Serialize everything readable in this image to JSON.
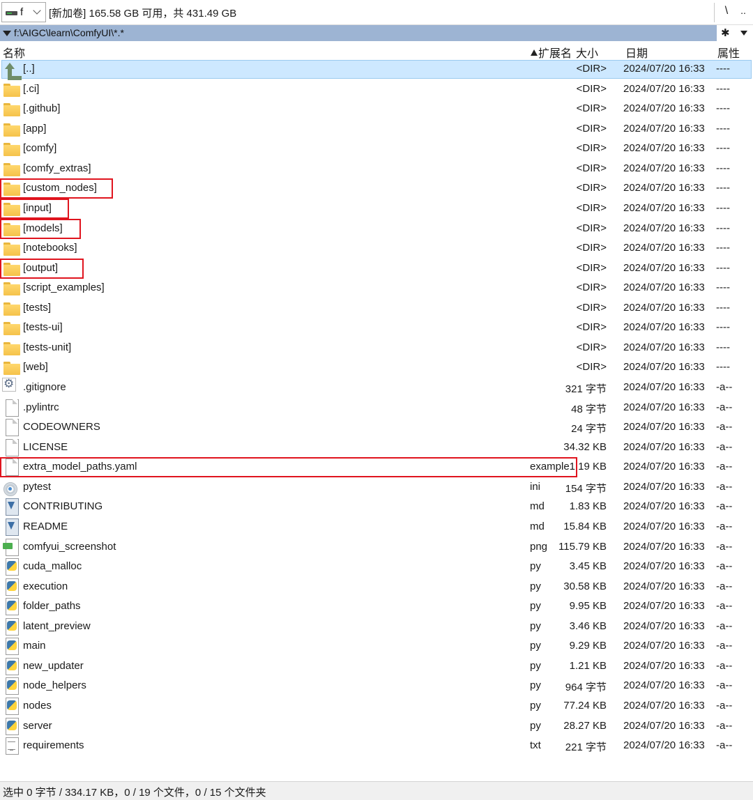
{
  "drive": {
    "letter": "f",
    "info": "[新加卷]  165.58 GB 可用，共 431.49 GB",
    "root_button": "\\",
    "up_button": ".."
  },
  "path": {
    "text": "f:\\AIGC\\learn\\ComfyUI\\*.*",
    "star_button": "✱"
  },
  "columns": {
    "name": "名称",
    "ext": "扩展名",
    "size": "大小",
    "date": "日期",
    "attr": "属性"
  },
  "colors": {
    "path_bar": "#9db4d3",
    "selection": "#cde8ff",
    "highlight_box": "#e0141e",
    "folder": "#f5c24a"
  },
  "files": [
    {
      "name": "[..]",
      "ext": "",
      "size": "<DIR>",
      "date": "2024/07/20 16:33",
      "attr": "----",
      "icon": "up-dir-icon",
      "selected": true
    },
    {
      "name": "[.ci]",
      "ext": "",
      "size": "<DIR>",
      "date": "2024/07/20 16:33",
      "attr": "----",
      "icon": "folder-icon"
    },
    {
      "name": "[.github]",
      "ext": "",
      "size": "<DIR>",
      "date": "2024/07/20 16:33",
      "attr": "----",
      "icon": "folder-icon"
    },
    {
      "name": "[app]",
      "ext": "",
      "size": "<DIR>",
      "date": "2024/07/20 16:33",
      "attr": "----",
      "icon": "folder-icon"
    },
    {
      "name": "[comfy]",
      "ext": "",
      "size": "<DIR>",
      "date": "2024/07/20 16:33",
      "attr": "----",
      "icon": "folder-icon"
    },
    {
      "name": "[comfy_extras]",
      "ext": "",
      "size": "<DIR>",
      "date": "2024/07/20 16:33",
      "attr": "----",
      "icon": "folder-icon"
    },
    {
      "name": "[custom_nodes]",
      "ext": "",
      "size": "<DIR>",
      "date": "2024/07/20 16:33",
      "attr": "----",
      "icon": "folder-icon",
      "highlighted": true
    },
    {
      "name": "[input]",
      "ext": "",
      "size": "<DIR>",
      "date": "2024/07/20 16:33",
      "attr": "----",
      "icon": "folder-icon",
      "highlighted": true
    },
    {
      "name": "[models]",
      "ext": "",
      "size": "<DIR>",
      "date": "2024/07/20 16:33",
      "attr": "----",
      "icon": "folder-icon",
      "highlighted": true
    },
    {
      "name": "[notebooks]",
      "ext": "",
      "size": "<DIR>",
      "date": "2024/07/20 16:33",
      "attr": "----",
      "icon": "folder-icon"
    },
    {
      "name": "[output]",
      "ext": "",
      "size": "<DIR>",
      "date": "2024/07/20 16:33",
      "attr": "----",
      "icon": "folder-icon",
      "highlighted": true
    },
    {
      "name": "[script_examples]",
      "ext": "",
      "size": "<DIR>",
      "date": "2024/07/20 16:33",
      "attr": "----",
      "icon": "folder-icon"
    },
    {
      "name": "[tests]",
      "ext": "",
      "size": "<DIR>",
      "date": "2024/07/20 16:33",
      "attr": "----",
      "icon": "folder-icon"
    },
    {
      "name": "[tests-ui]",
      "ext": "",
      "size": "<DIR>",
      "date": "2024/07/20 16:33",
      "attr": "----",
      "icon": "folder-icon"
    },
    {
      "name": "[tests-unit]",
      "ext": "",
      "size": "<DIR>",
      "date": "2024/07/20 16:33",
      "attr": "----",
      "icon": "folder-icon"
    },
    {
      "name": "[web]",
      "ext": "",
      "size": "<DIR>",
      "date": "2024/07/20 16:33",
      "attr": "----",
      "icon": "folder-icon"
    },
    {
      "name": ".gitignore",
      "ext": "",
      "size": "321 字节",
      "date": "2024/07/20 16:33",
      "attr": "-a--",
      "icon": "gear-file-icon"
    },
    {
      "name": ".pylintrc",
      "ext": "",
      "size": "48 字节",
      "date": "2024/07/20 16:33",
      "attr": "-a--",
      "icon": "file-icon"
    },
    {
      "name": "CODEOWNERS",
      "ext": "",
      "size": "24 字节",
      "date": "2024/07/20 16:33",
      "attr": "-a--",
      "icon": "file-icon"
    },
    {
      "name": "LICENSE",
      "ext": "",
      "size": "34.32 KB",
      "date": "2024/07/20 16:33",
      "attr": "-a--",
      "icon": "file-icon"
    },
    {
      "name": "extra_model_paths.yaml",
      "ext": "example",
      "size": "1.19 KB",
      "date": "2024/07/20 16:33",
      "attr": "-a--",
      "icon": "file-icon",
      "highlighted": true
    },
    {
      "name": "pytest",
      "ext": "ini",
      "size": "154 字节",
      "date": "2024/07/20 16:33",
      "attr": "-a--",
      "icon": "ini-settings-icon"
    },
    {
      "name": "CONTRIBUTING",
      "ext": "md",
      "size": "1.83 KB",
      "date": "2024/07/20 16:33",
      "attr": "-a--",
      "icon": "markdown-icon"
    },
    {
      "name": "README",
      "ext": "md",
      "size": "15.84 KB",
      "date": "2024/07/20 16:33",
      "attr": "-a--",
      "icon": "markdown-icon"
    },
    {
      "name": "comfyui_screenshot",
      "ext": "png",
      "size": "115.79 KB",
      "date": "2024/07/20 16:33",
      "attr": "-a--",
      "icon": "png-image-icon"
    },
    {
      "name": "cuda_malloc",
      "ext": "py",
      "size": "3.45 KB",
      "date": "2024/07/20 16:33",
      "attr": "-a--",
      "icon": "python-icon"
    },
    {
      "name": "execution",
      "ext": "py",
      "size": "30.58 KB",
      "date": "2024/07/20 16:33",
      "attr": "-a--",
      "icon": "python-icon"
    },
    {
      "name": "folder_paths",
      "ext": "py",
      "size": "9.95 KB",
      "date": "2024/07/20 16:33",
      "attr": "-a--",
      "icon": "python-icon"
    },
    {
      "name": "latent_preview",
      "ext": "py",
      "size": "3.46 KB",
      "date": "2024/07/20 16:33",
      "attr": "-a--",
      "icon": "python-icon"
    },
    {
      "name": "main",
      "ext": "py",
      "size": "9.29 KB",
      "date": "2024/07/20 16:33",
      "attr": "-a--",
      "icon": "python-icon"
    },
    {
      "name": "new_updater",
      "ext": "py",
      "size": "1.21 KB",
      "date": "2024/07/20 16:33",
      "attr": "-a--",
      "icon": "python-icon"
    },
    {
      "name": "node_helpers",
      "ext": "py",
      "size": "964 字节",
      "date": "2024/07/20 16:33",
      "attr": "-a--",
      "icon": "python-icon"
    },
    {
      "name": "nodes",
      "ext": "py",
      "size": "77.24 KB",
      "date": "2024/07/20 16:33",
      "attr": "-a--",
      "icon": "python-icon"
    },
    {
      "name": "server",
      "ext": "py",
      "size": "28.27 KB",
      "date": "2024/07/20 16:33",
      "attr": "-a--",
      "icon": "python-icon"
    },
    {
      "name": "requirements",
      "ext": "txt",
      "size": "221 字节",
      "date": "2024/07/20 16:33",
      "attr": "-a--",
      "icon": "text-file-icon"
    }
  ],
  "status": {
    "text": "选中 0 字节 / 334.17 KB，0 / 19 个文件，0 / 15 个文件夹"
  }
}
